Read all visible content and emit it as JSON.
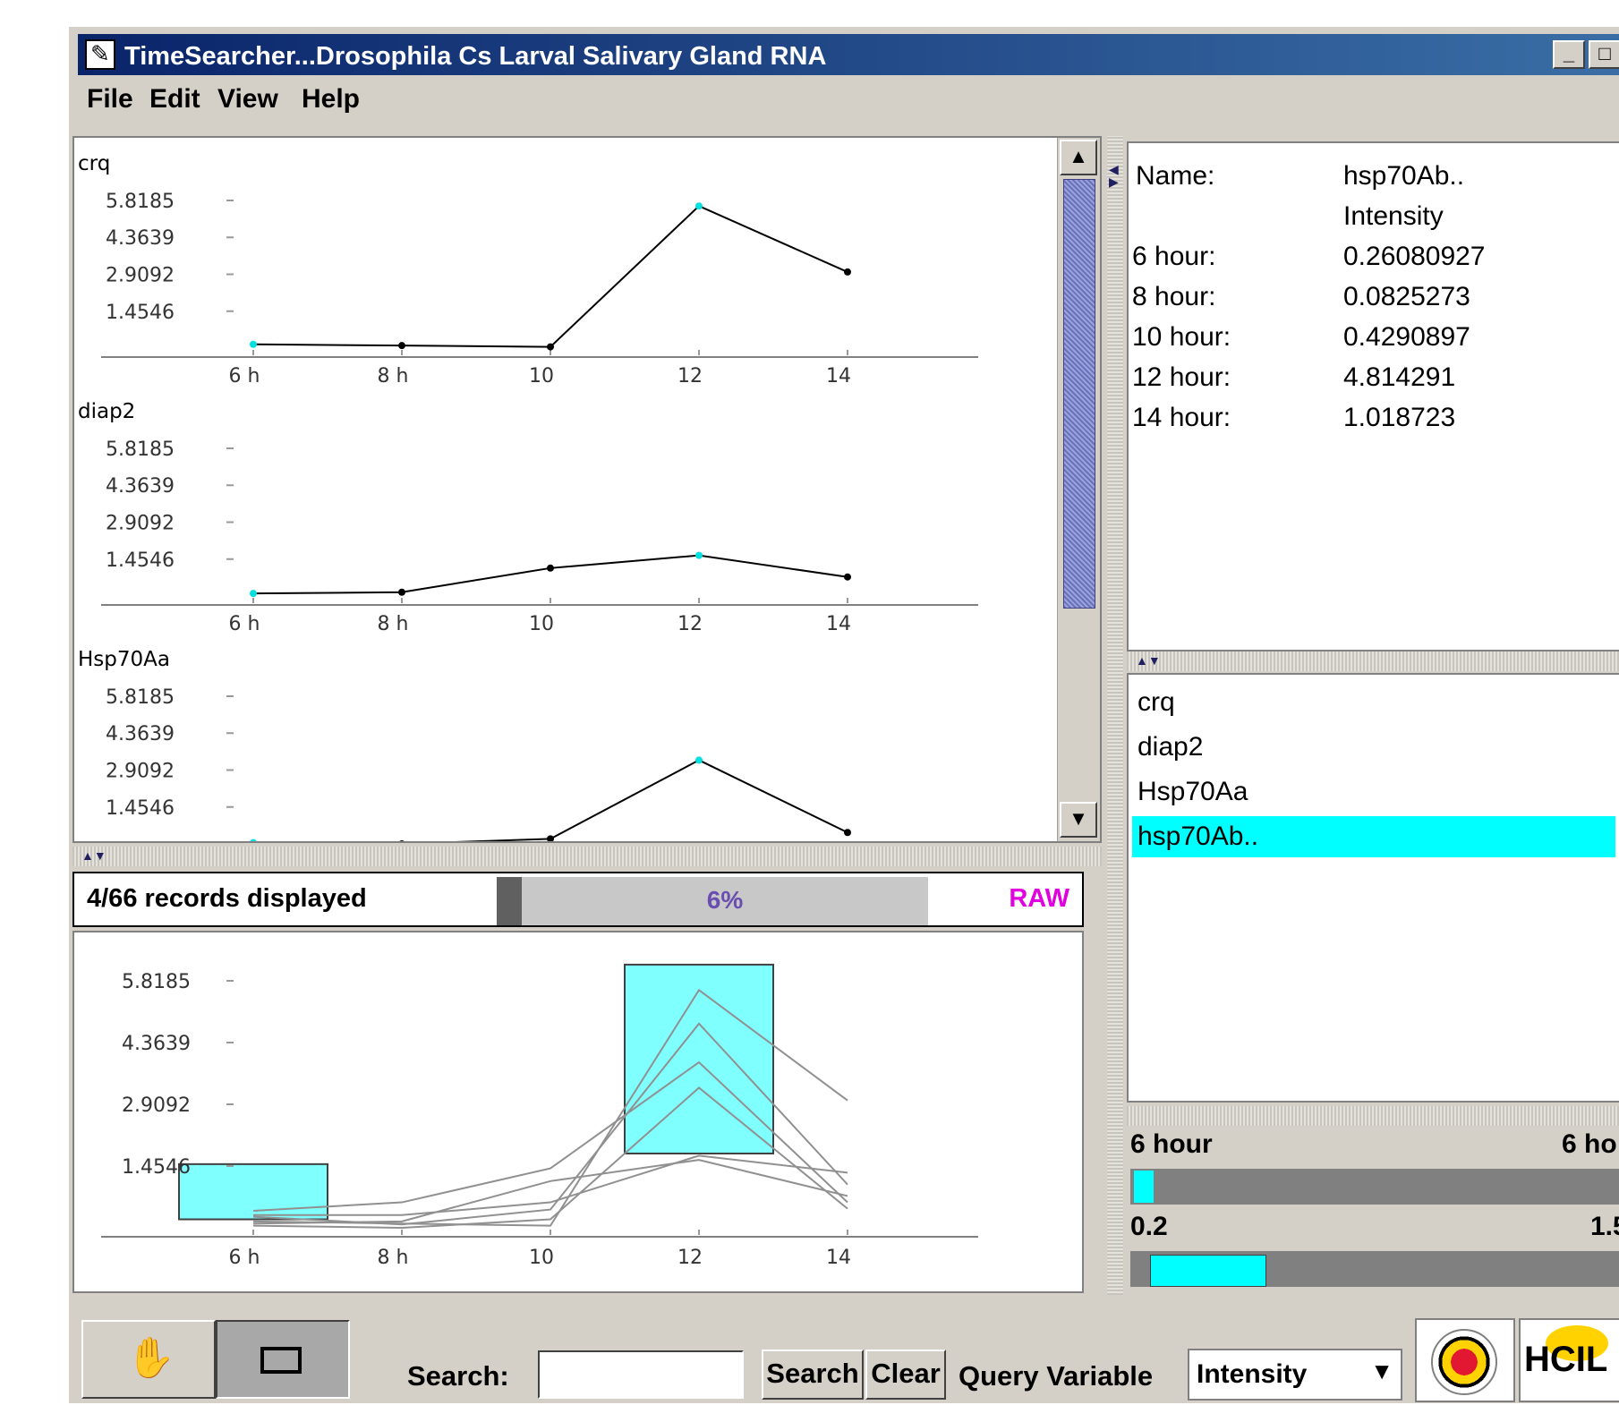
{
  "window": {
    "title": "TimeSearcher...Drosophila Cs Larval Salivary Gland RNA",
    "minimize": "_",
    "maximize": "□"
  },
  "menu": [
    "File",
    "Edit",
    "View",
    "Help"
  ],
  "detail_charts": [
    {
      "name": "crq",
      "values": [
        0.15,
        0.1,
        0.05,
        5.6,
        3.0
      ]
    },
    {
      "name": "diap2",
      "values": [
        0.1,
        0.15,
        1.1,
        1.6,
        0.75
      ]
    },
    {
      "name": "Hsp70Aa",
      "values": [
        0.05,
        0.0,
        0.2,
        3.3,
        0.45
      ]
    }
  ],
  "y_ticks": [
    "5.8185",
    "4.3639",
    "2.9092",
    "1.4546"
  ],
  "x_ticks": [
    "6 h",
    "8 h",
    "10",
    "12",
    "14"
  ],
  "status": {
    "records": "4/66 records displayed",
    "percent": "6%",
    "percent_value": 0.06,
    "mode": "RAW"
  },
  "overview": {
    "series": [
      [
        0.15,
        0.1,
        0.05,
        5.6,
        3.0
      ],
      [
        0.1,
        0.15,
        1.1,
        1.6,
        0.75
      ],
      [
        0.05,
        0.0,
        0.2,
        3.3,
        0.45
      ],
      [
        0.26,
        0.08,
        0.43,
        4.81,
        1.02
      ],
      [
        0.4,
        0.6,
        1.4,
        3.9,
        0.6
      ],
      [
        0.3,
        0.3,
        0.6,
        1.7,
        1.3
      ]
    ],
    "boxes": [
      {
        "x0": 5.0,
        "x1": 7.0,
        "y0": 0.2,
        "y1": 1.5
      },
      {
        "x0": 11.0,
        "x1": 13.0,
        "y0": 1.75,
        "y1": 6.2
      }
    ]
  },
  "details": {
    "name_label": "Name:",
    "name_value": "hsp70Ab..",
    "variable": "Intensity",
    "rows": [
      {
        "label": "6 hour:",
        "value": "0.26080927"
      },
      {
        "label": "8 hour:",
        "value": "0.0825273"
      },
      {
        "label": "10 hour:",
        "value": "0.4290897"
      },
      {
        "label": "12 hour:",
        "value": "4.814291"
      },
      {
        "label": "14 hour:",
        "value": "1.018723"
      }
    ]
  },
  "record_list": [
    "crq",
    "diap2",
    "Hsp70Aa",
    "hsp70Ab.."
  ],
  "selected_record": "hsp70Ab..",
  "range_time": {
    "left": "6 hour",
    "right": "6 ho"
  },
  "range_value": {
    "left": "0.2",
    "right": "1.5"
  },
  "toolbar": {
    "search_label": "Search:",
    "search_value": "",
    "search_button": "Search",
    "clear_button": "Clear",
    "query_label": "Query Variable",
    "query_value": "Intensity",
    "hcil": "HCIL"
  },
  "colors": {
    "accent": "#00ffff",
    "title_start": "#0a246a",
    "raw": "#e000e0"
  }
}
